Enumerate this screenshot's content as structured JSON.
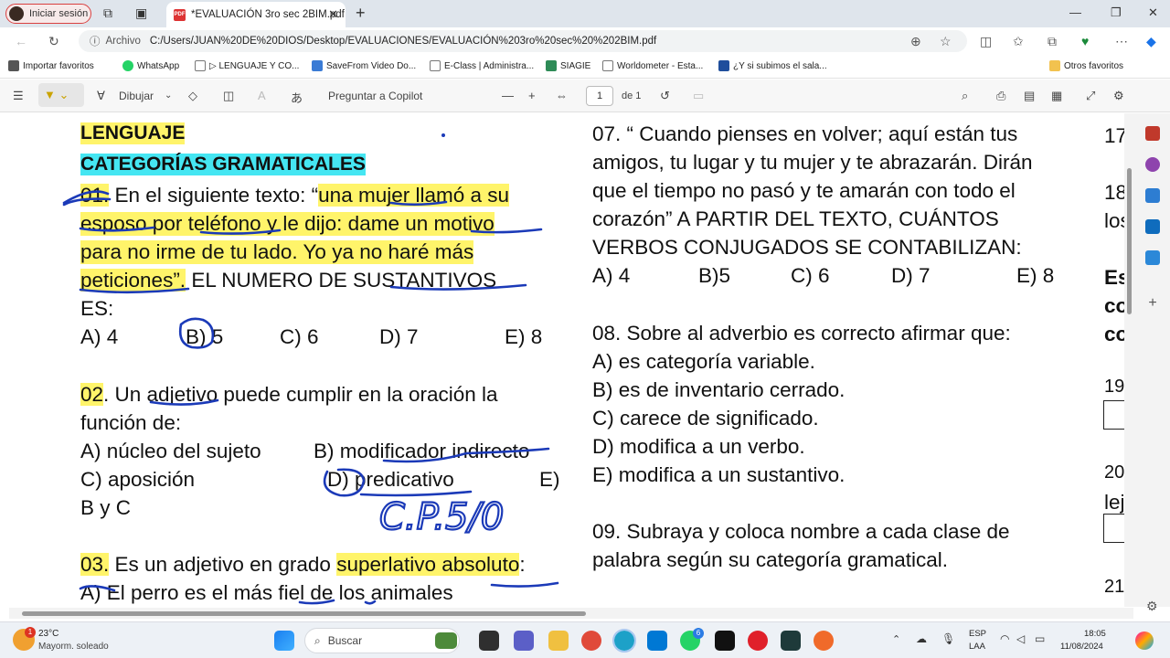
{
  "browser": {
    "profile_label": "Iniciar sesión",
    "tab_title": "*EVALUACIÓN 3ro sec 2BIM.pdf",
    "tab_close": "✕",
    "new_tab": "+",
    "address_prefix": "Archivo",
    "address_url": "C:/Users/JUAN%20DE%20DIOS/Desktop/EVALUACIONES/EVALUACIÓN%203ro%20sec%20%202BIM.pdf",
    "bookmarks": [
      {
        "label": "Importar favoritos",
        "color": "#555555"
      },
      {
        "label": "WhatsApp",
        "color": "#25d366"
      },
      {
        "label": "▷ LENGUAJE Y CO...",
        "color": "#777777"
      },
      {
        "label": "SaveFrom Video Do...",
        "color": "#3a7bd5"
      },
      {
        "label": "E-Class | Administra...",
        "color": "#666666"
      },
      {
        "label": "SIAGIE",
        "color": "#2e8b57"
      },
      {
        "label": "Worldometer - Esta...",
        "color": "#444444"
      },
      {
        "label": "¿Y si subimos el sala...",
        "color": "#1f4e9c"
      }
    ],
    "other_favorites": "Otros favoritos"
  },
  "pdf_toolbar": {
    "draw_label": "Dibujar",
    "copilot_label": "Preguntar a Copilot",
    "page_current": "1",
    "page_total": "de 1"
  },
  "document": {
    "col1": {
      "heading1": "LENGUAJE",
      "heading2": "CATEGORÍAS GRAMATICALES",
      "q1_num": "01.",
      "q1_line1_a": " En el siguiente texto: “",
      "q1_line1_b": "una mujer llamó a su",
      "q1_line2": "esposo por teléfono y le dijo: dame un motivo",
      "q1_line3": "para no irme de tu lado. Yo ya no haré más",
      "q1_line4_a": "peticiones”.",
      "q1_line4_b": "  EL NUMERO DE SUSTANTIVOS",
      "q1_line5": "ES:",
      "q1_opts": [
        "A) 4",
        "B) 5",
        "C) 6",
        "D) 7",
        "E) 8"
      ],
      "q2_num": "02",
      "q2_line1": ". Un adjetivo puede cumplir en la oración la",
      "q2_line2": "función de:",
      "q2_optA": "A) núcleo del sujeto",
      "q2_optB": "B) modificador indirecto",
      "q2_optC": "C) aposición",
      "q2_optD": "D) predicativo",
      "q2_optE": "E)",
      "q2_optE2": "B y C",
      "handwritten_note": "C.P.5/0",
      "q3_num": "03.",
      "q3_line1_a": " Es un adjetivo en grado ",
      "q3_line1_b": "superlativo absoluto",
      "q3_line1_c": ":",
      "q3_line2": "A) El perro es el más fiel de los animales"
    },
    "col2": {
      "q7_line1": "07. “ Cuando pienses en volver; aquí están tus",
      "q7_line2": "amigos, tu lugar y tu mujer y te abrazarán. Dirán",
      "q7_line3": "que el tiempo no pasó y te amarán con todo el",
      "q7_line4": "corazón”  A PARTIR DEL TEXTO, CUÁNTOS",
      "q7_line5": "VERBOS CONJUGADOS SE CONTABILIZAN:",
      "q7_opts": [
        "A) 4",
        "B)5",
        "C) 6",
        "D) 7",
        "E) 8"
      ],
      "q8_line1": "08.  Sobre al adverbio es correcto afirmar que:",
      "q8_opts": [
        "A) es categoría variable.",
        "B) es de inventario cerrado.",
        "C) carece de significado.",
        "D) modifica a un verbo.",
        "E) modifica a un sustantivo."
      ],
      "q9_line1": "09. Subraya y coloca nombre a cada clase de",
      "q9_line2": "palabra según su categoría gramatical."
    },
    "col3": [
      "17",
      "18",
      "los",
      "Es",
      "co",
      "co",
      "19",
      "20",
      "lej",
      "21"
    ]
  },
  "taskbar": {
    "weather_temp": "23°C",
    "weather_desc": "Mayorm. soleado",
    "weather_badge": "1",
    "search_placeholder": "Buscar",
    "lang_line1": "ESP",
    "lang_line2": "LAA",
    "time": "18:05",
    "date": "11/08/2024",
    "whatsapp_badge": "6"
  }
}
